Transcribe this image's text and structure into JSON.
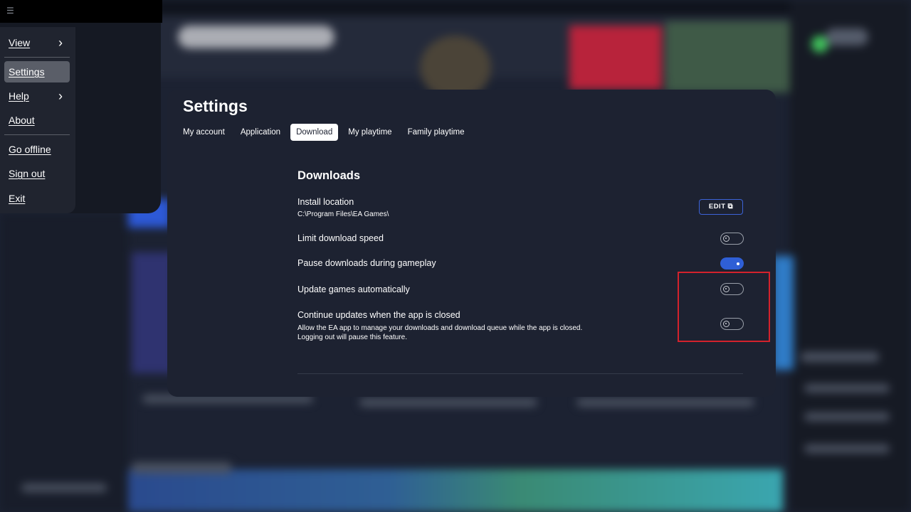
{
  "menu": {
    "hamburger_icon": "☰",
    "items": [
      {
        "label": "View",
        "has_submenu": true
      },
      {
        "label": "Settings",
        "active": true
      },
      {
        "label": "Help",
        "has_submenu": true
      },
      {
        "label": "About"
      },
      {
        "label": "Go offline"
      },
      {
        "label": "Sign out"
      },
      {
        "label": "Exit"
      }
    ],
    "chevron": "›"
  },
  "settings": {
    "title": "Settings",
    "tabs": [
      {
        "label": "My account"
      },
      {
        "label": "Application"
      },
      {
        "label": "Download",
        "active": true
      },
      {
        "label": "My playtime"
      },
      {
        "label": "Family playtime"
      }
    ],
    "section_title": "Downloads",
    "install_location": {
      "label": "Install location",
      "value": "C:\\Program Files\\EA Games\\",
      "edit_label": "EDIT",
      "edit_icon": "external-link-icon"
    },
    "options": [
      {
        "label": "Limit download speed",
        "enabled": false
      },
      {
        "label": "Pause downloads during gameplay",
        "enabled": true
      },
      {
        "label": "Update games automatically",
        "enabled": false
      },
      {
        "label": "Continue updates when the app is closed",
        "description_line1": "Allow the EA app to manage your downloads and download queue while the app is closed.",
        "description_line2": "Logging out will pause this feature.",
        "enabled": false
      }
    ]
  },
  "colors": {
    "accent": "#2f5fd6",
    "highlight": "#d3222c",
    "dialog_bg": "#1d2231"
  }
}
